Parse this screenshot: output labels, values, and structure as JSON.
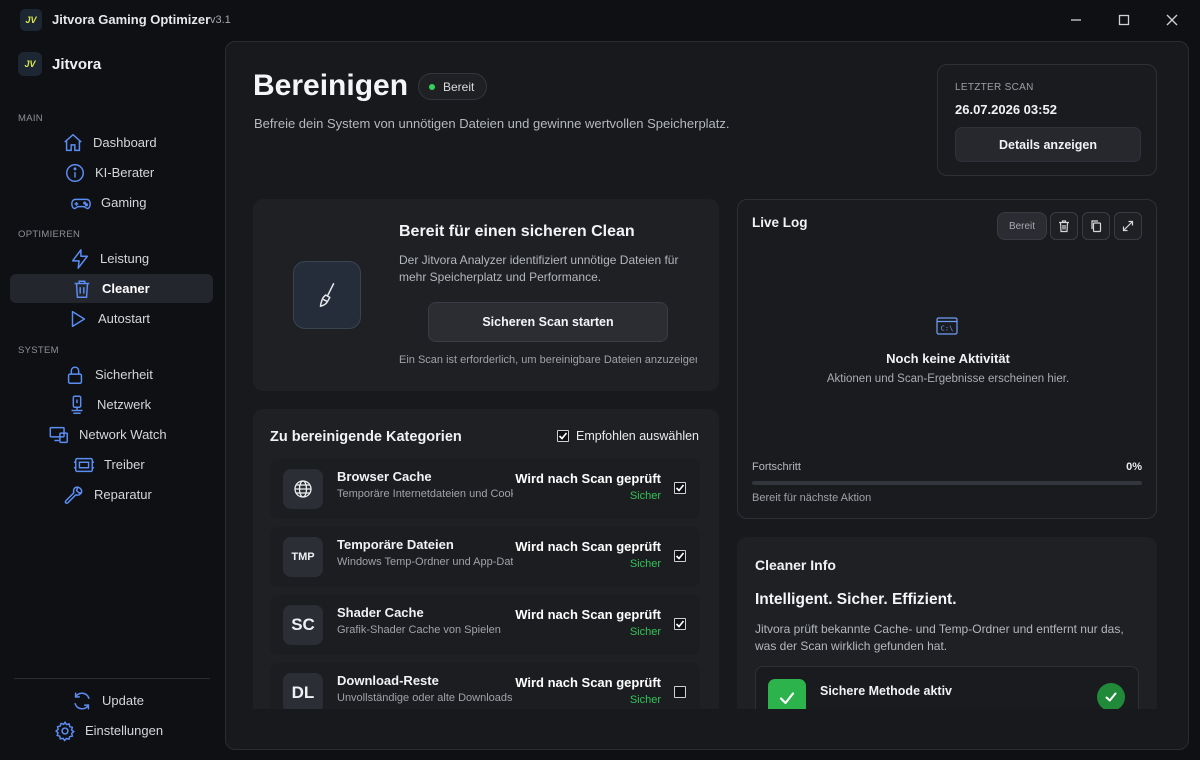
{
  "titlebar": {
    "app_title": "Jitvora Gaming Optimizer",
    "version": "v3.1",
    "logo_text": "JV"
  },
  "sidebar": {
    "brand_name": "Jitvora",
    "sections": {
      "main": "MAIN",
      "optimize": "OPTIMIEREN",
      "system": "SYSTEM"
    },
    "items": {
      "dashboard": "Dashboard",
      "ki_berater": "KI-Berater",
      "gaming": "Gaming",
      "leistung": "Leistung",
      "cleaner": "Cleaner",
      "autostart": "Autostart",
      "sicherheit": "Sicherheit",
      "netzwerk": "Netzwerk",
      "network_watch": "Network Watch",
      "treiber": "Treiber",
      "reparatur": "Reparatur"
    },
    "bottom": {
      "update": "Update",
      "settings": "Einstellungen"
    },
    "active": "cleaner"
  },
  "header": {
    "title": "Bereinigen",
    "status": "Bereit",
    "subtitle": "Befreie dein System von unnötigen Dateien und gewinne wertvollen Speicherplatz."
  },
  "last_scan": {
    "label": "LETZTER SCAN",
    "date": "26.07.2026 03:52",
    "button": "Details anzeigen"
  },
  "hero": {
    "title": "Bereit für einen sicheren Clean",
    "description": "Der Jitvora Analyzer identifiziert unnötige Dateien für mehr Speicherplatz und Performance.",
    "button": "Sicheren Scan starten",
    "note": "Ein Scan ist erforderlich, um bereinigbare Dateien anzuzeigen."
  },
  "categories": {
    "title": "Zu bereinigende Kategorien",
    "recommended_label": "Empfohlen auswählen",
    "recommended_checked": true,
    "items": [
      {
        "icon_text": "",
        "icon": "globe-icon",
        "name": "Browser Cache",
        "desc": "Temporäre Internetdateien und Cookies",
        "status": "Wird nach Scan geprüft",
        "safety": "Sicher",
        "checked": true
      },
      {
        "icon_text": "TMP",
        "icon": "tmp-icon",
        "name": "Temporäre Dateien",
        "desc": "Windows Temp-Ordner und App-Daten",
        "status": "Wird nach Scan geprüft",
        "safety": "Sicher",
        "checked": true
      },
      {
        "icon_text": "SC",
        "icon": "shader-icon",
        "name": "Shader Cache",
        "desc": "Grafik-Shader Cache von Spielen",
        "status": "Wird nach Scan geprüft",
        "safety": "Sicher",
        "checked": true
      },
      {
        "icon_text": "DL",
        "icon": "download-icon",
        "name": "Download-Reste",
        "desc": "Unvollständige oder alte Downloads",
        "status": "Wird nach Scan geprüft",
        "safety": "Sicher",
        "checked": false
      }
    ]
  },
  "live_log": {
    "title": "Live Log",
    "badge": "Bereit",
    "empty_title": "Noch keine Aktivität",
    "empty_sub": "Aktionen und Scan-Ergebnisse erscheinen hier.",
    "progress_label": "Fortschritt",
    "progress_text": "0%",
    "progress_value": 0,
    "status": "Bereit für nächste Aktion",
    "empty_icon_text": "C:\\"
  },
  "cleaner_info": {
    "title": "Cleaner Info",
    "headline": "Intelligent. Sicher. Effizient.",
    "description": "Jitvora prüft bekannte Cache- und Temp-Ordner und entfernt nur das, was der Scan wirklich gefunden hat.",
    "row_label": "Sichere Methode aktiv"
  },
  "colors": {
    "accent": "#5b8ef5",
    "safe": "#33c458",
    "ready_dot": "#35d05a"
  }
}
